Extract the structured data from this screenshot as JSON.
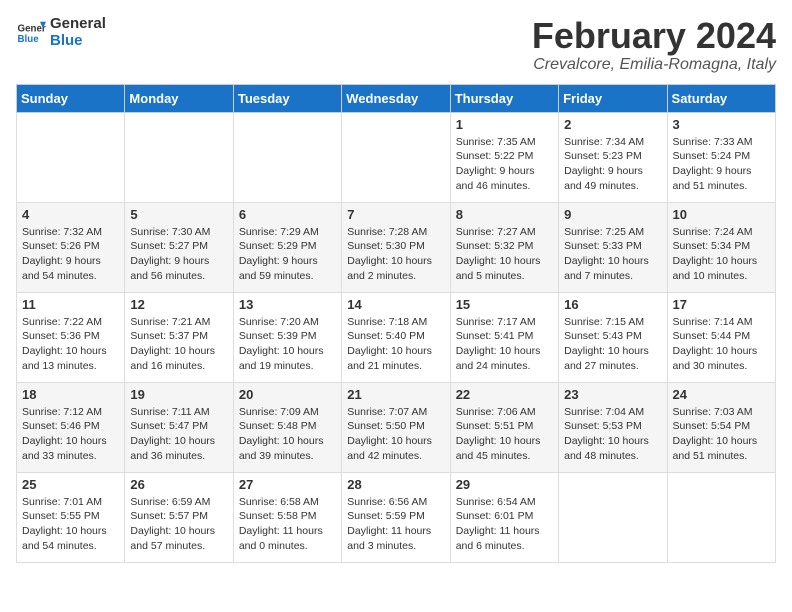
{
  "logo": {
    "line1": "General",
    "line2": "Blue"
  },
  "title": "February 2024",
  "subtitle": "Crevalcore, Emilia-Romagna, Italy",
  "days_of_week": [
    "Sunday",
    "Monday",
    "Tuesday",
    "Wednesday",
    "Thursday",
    "Friday",
    "Saturday"
  ],
  "weeks": [
    [
      {
        "day": "",
        "info": ""
      },
      {
        "day": "",
        "info": ""
      },
      {
        "day": "",
        "info": ""
      },
      {
        "day": "",
        "info": ""
      },
      {
        "day": "1",
        "info": "Sunrise: 7:35 AM\nSunset: 5:22 PM\nDaylight: 9 hours and 46 minutes."
      },
      {
        "day": "2",
        "info": "Sunrise: 7:34 AM\nSunset: 5:23 PM\nDaylight: 9 hours and 49 minutes."
      },
      {
        "day": "3",
        "info": "Sunrise: 7:33 AM\nSunset: 5:24 PM\nDaylight: 9 hours and 51 minutes."
      }
    ],
    [
      {
        "day": "4",
        "info": "Sunrise: 7:32 AM\nSunset: 5:26 PM\nDaylight: 9 hours and 54 minutes."
      },
      {
        "day": "5",
        "info": "Sunrise: 7:30 AM\nSunset: 5:27 PM\nDaylight: 9 hours and 56 minutes."
      },
      {
        "day": "6",
        "info": "Sunrise: 7:29 AM\nSunset: 5:29 PM\nDaylight: 9 hours and 59 minutes."
      },
      {
        "day": "7",
        "info": "Sunrise: 7:28 AM\nSunset: 5:30 PM\nDaylight: 10 hours and 2 minutes."
      },
      {
        "day": "8",
        "info": "Sunrise: 7:27 AM\nSunset: 5:32 PM\nDaylight: 10 hours and 5 minutes."
      },
      {
        "day": "9",
        "info": "Sunrise: 7:25 AM\nSunset: 5:33 PM\nDaylight: 10 hours and 7 minutes."
      },
      {
        "day": "10",
        "info": "Sunrise: 7:24 AM\nSunset: 5:34 PM\nDaylight: 10 hours and 10 minutes."
      }
    ],
    [
      {
        "day": "11",
        "info": "Sunrise: 7:22 AM\nSunset: 5:36 PM\nDaylight: 10 hours and 13 minutes."
      },
      {
        "day": "12",
        "info": "Sunrise: 7:21 AM\nSunset: 5:37 PM\nDaylight: 10 hours and 16 minutes."
      },
      {
        "day": "13",
        "info": "Sunrise: 7:20 AM\nSunset: 5:39 PM\nDaylight: 10 hours and 19 minutes."
      },
      {
        "day": "14",
        "info": "Sunrise: 7:18 AM\nSunset: 5:40 PM\nDaylight: 10 hours and 21 minutes."
      },
      {
        "day": "15",
        "info": "Sunrise: 7:17 AM\nSunset: 5:41 PM\nDaylight: 10 hours and 24 minutes."
      },
      {
        "day": "16",
        "info": "Sunrise: 7:15 AM\nSunset: 5:43 PM\nDaylight: 10 hours and 27 minutes."
      },
      {
        "day": "17",
        "info": "Sunrise: 7:14 AM\nSunset: 5:44 PM\nDaylight: 10 hours and 30 minutes."
      }
    ],
    [
      {
        "day": "18",
        "info": "Sunrise: 7:12 AM\nSunset: 5:46 PM\nDaylight: 10 hours and 33 minutes."
      },
      {
        "day": "19",
        "info": "Sunrise: 7:11 AM\nSunset: 5:47 PM\nDaylight: 10 hours and 36 minutes."
      },
      {
        "day": "20",
        "info": "Sunrise: 7:09 AM\nSunset: 5:48 PM\nDaylight: 10 hours and 39 minutes."
      },
      {
        "day": "21",
        "info": "Sunrise: 7:07 AM\nSunset: 5:50 PM\nDaylight: 10 hours and 42 minutes."
      },
      {
        "day": "22",
        "info": "Sunrise: 7:06 AM\nSunset: 5:51 PM\nDaylight: 10 hours and 45 minutes."
      },
      {
        "day": "23",
        "info": "Sunrise: 7:04 AM\nSunset: 5:53 PM\nDaylight: 10 hours and 48 minutes."
      },
      {
        "day": "24",
        "info": "Sunrise: 7:03 AM\nSunset: 5:54 PM\nDaylight: 10 hours and 51 minutes."
      }
    ],
    [
      {
        "day": "25",
        "info": "Sunrise: 7:01 AM\nSunset: 5:55 PM\nDaylight: 10 hours and 54 minutes."
      },
      {
        "day": "26",
        "info": "Sunrise: 6:59 AM\nSunset: 5:57 PM\nDaylight: 10 hours and 57 minutes."
      },
      {
        "day": "27",
        "info": "Sunrise: 6:58 AM\nSunset: 5:58 PM\nDaylight: 11 hours and 0 minutes."
      },
      {
        "day": "28",
        "info": "Sunrise: 6:56 AM\nSunset: 5:59 PM\nDaylight: 11 hours and 3 minutes."
      },
      {
        "day": "29",
        "info": "Sunrise: 6:54 AM\nSunset: 6:01 PM\nDaylight: 11 hours and 6 minutes."
      },
      {
        "day": "",
        "info": ""
      },
      {
        "day": "",
        "info": ""
      }
    ]
  ]
}
